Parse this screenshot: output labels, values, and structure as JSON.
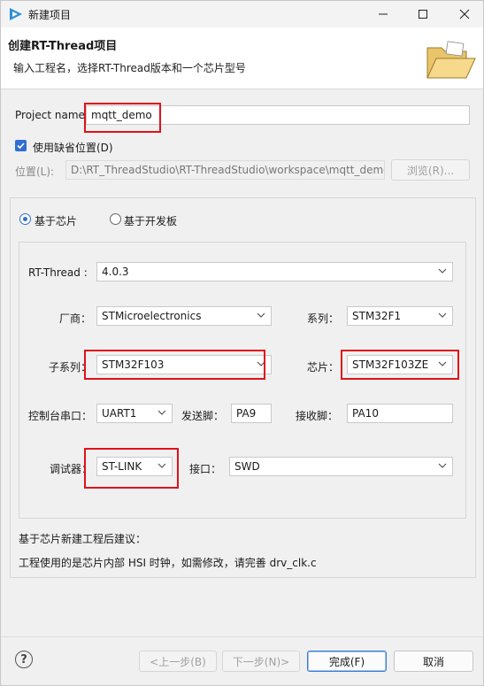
{
  "window": {
    "title": "新建项目"
  },
  "banner": {
    "title": "创建RT-Thread项目",
    "subtitle": "输入工程名，选择RT-Thread版本和一个芯片型号",
    "icon": "folder-open-icon"
  },
  "project": {
    "name_label": "Project name",
    "name_value": "mqtt_demo",
    "use_default_label": "使用缺省位置(D)",
    "use_default_checked": true,
    "location_label": "位置(L):",
    "location_value": "D:\\RT_ThreadStudio\\RT-ThreadStudio\\workspace\\mqtt_demo",
    "browse_label": "浏览(R)..."
  },
  "mode": {
    "chip_label": "基于芯片",
    "board_label": "基于开发板",
    "selected": "chip"
  },
  "chip": {
    "rtthread_label": "RT-Thread :",
    "rtthread_value": "4.0.3",
    "vendor_label": "厂商：",
    "vendor_value": "STMicroelectronics",
    "series_label": "系列：",
    "series_value": "STM32F1",
    "subseries_label": "子系列：",
    "subseries_value": "STM32F103",
    "chip_label": "芯片：",
    "chip_value": "STM32F103ZE",
    "console_label": "控制台串口：",
    "console_value": "UART1",
    "tx_label": "发送脚：",
    "tx_value": "PA9",
    "rx_label": "接收脚：",
    "rx_value": "PA10",
    "debugger_label": "调试器：",
    "debugger_value": "ST-LINK",
    "interface_label": "接口：",
    "interface_value": "SWD"
  },
  "advice": {
    "heading": "基于芯片新建工程后建议：",
    "text": "工程使用的是芯片内部 HSI 时钟，如需修改，请完善 drv_clk.c"
  },
  "footer": {
    "back_label": "<上一步(B)",
    "next_label": "下一步(N)>",
    "finish_label": "完成(F)",
    "cancel_label": "取消"
  },
  "colors": {
    "accent": "#2f6fd1",
    "highlight": "#e0121a"
  }
}
